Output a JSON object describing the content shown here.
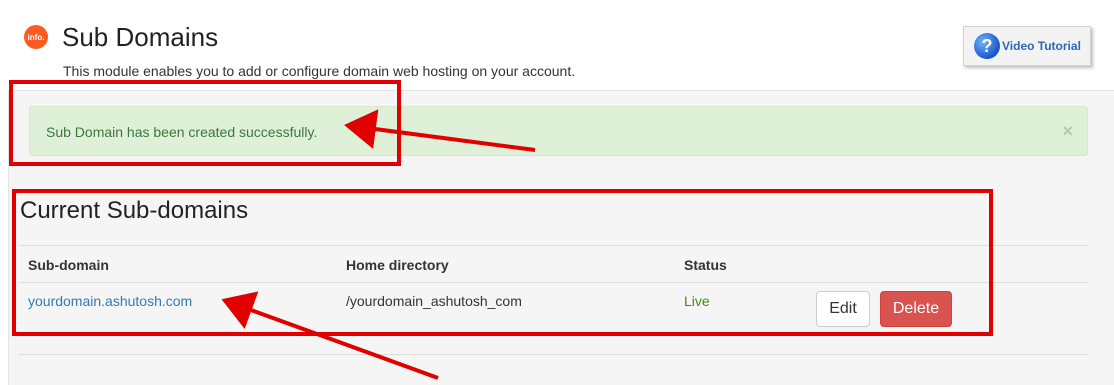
{
  "header": {
    "icon_text": "info.",
    "title": "Sub Domains",
    "description": "This module enables you to add or configure domain web hosting on your account.",
    "video_button": {
      "icon": "question-icon",
      "icon_glyph": "?",
      "label": "Video Tutorial"
    }
  },
  "alert": {
    "message": "Sub Domain has been created successfully.",
    "close_glyph": "×"
  },
  "section": {
    "title": "Current Sub-domains",
    "columns": [
      "Sub-domain",
      "Home directory",
      "Status"
    ],
    "rows": [
      {
        "subdomain": "yourdomain.ashutosh.com",
        "home_directory": "/yourdomain_ashutosh_com",
        "status": "Live",
        "edit_label": "Edit",
        "delete_label": "Delete"
      }
    ]
  },
  "colors": {
    "highlight": "#e00000",
    "success_bg": "#dff0d8",
    "success_text": "#3c763d",
    "link": "#337ab7",
    "danger": "#d9534f"
  }
}
